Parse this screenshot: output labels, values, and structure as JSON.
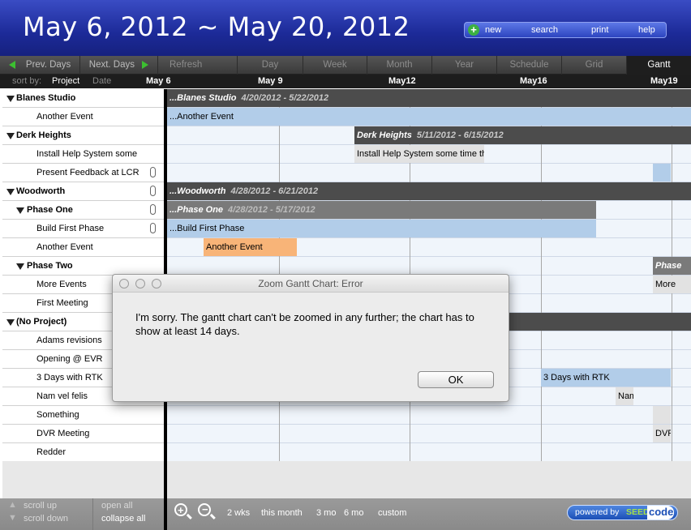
{
  "header": {
    "title": "May 6, 2012 ~ May 20, 2012",
    "buttons": [
      "new",
      "search",
      "print",
      "help"
    ]
  },
  "navbar": {
    "prev": "Prev. Days",
    "next": "Next. Days",
    "refresh": "Refresh",
    "views": [
      "Day",
      "Week",
      "Month",
      "Year",
      "Schedule",
      "Grid",
      "Gantt"
    ],
    "active_view": "Gantt"
  },
  "sortbar": {
    "label": "sort by:",
    "project": "Project",
    "date": "Date",
    "dates": [
      "May 6",
      "May 9",
      "May12",
      "May16",
      "May19"
    ]
  },
  "rows": [
    {
      "label": "Blanes Studio",
      "group": true
    },
    {
      "label": "Another Event"
    },
    {
      "label": "Derk Heights",
      "group": true
    },
    {
      "label": "Install Help System some"
    },
    {
      "label": "Present Feedback at LCR",
      "clip": true
    },
    {
      "label": "Woodworth",
      "group": true,
      "clip": true
    },
    {
      "label": "Phase One",
      "group": true,
      "clip": true
    },
    {
      "label": "Build First Phase",
      "clip": true
    },
    {
      "label": "Another Event"
    },
    {
      "label": "Phase Two",
      "group": true
    },
    {
      "label": "More Events"
    },
    {
      "label": "First Meeting"
    },
    {
      "label": "(No Project)",
      "group": true
    },
    {
      "label": "Adams revisions"
    },
    {
      "label": "Opening @ EVR"
    },
    {
      "label": "3 Days with RTK"
    },
    {
      "label": "Nam vel felis"
    },
    {
      "label": "Something"
    },
    {
      "label": "DVR Meeting"
    },
    {
      "label": "Redder"
    }
  ],
  "bars": {
    "blanes": {
      "name": "...Blanes Studio",
      "dates": "4/20/2012 - 5/22/2012"
    },
    "blanes_event": "...Another Event",
    "derk": {
      "name": "Derk Heights",
      "dates": "5/11/2012 - 6/15/2012"
    },
    "install": "Install Help System some time this",
    "woodworth": {
      "name": "...Woodworth",
      "dates": "4/28/2012 - 6/21/2012"
    },
    "phaseone": {
      "name": "...Phase One",
      "dates": "4/28/2012 - 5/17/2012"
    },
    "buildfirst": "...Build First Phase",
    "another": "Another Event",
    "phasetwo": "Phase",
    "more": "More",
    "rtk": "3 Days with RTK",
    "nam": "Nam",
    "dvr": "DVR"
  },
  "dialog": {
    "title": "Zoom Gantt Chart: Error",
    "message": "I'm sorry. The gantt chart can't be zoomed in any further; the chart has to show at least 14 days.",
    "ok": "OK"
  },
  "footer": {
    "scroll_up": "scroll up",
    "scroll_down": "scroll down",
    "open_all": "open all",
    "collapse_all": "collapse all",
    "ranges": [
      "2 wks",
      "this month",
      "3 mo",
      "6 mo",
      "custom"
    ],
    "powered_by": "powered by",
    "brand_seed": "SEED",
    "brand_code": "code"
  }
}
